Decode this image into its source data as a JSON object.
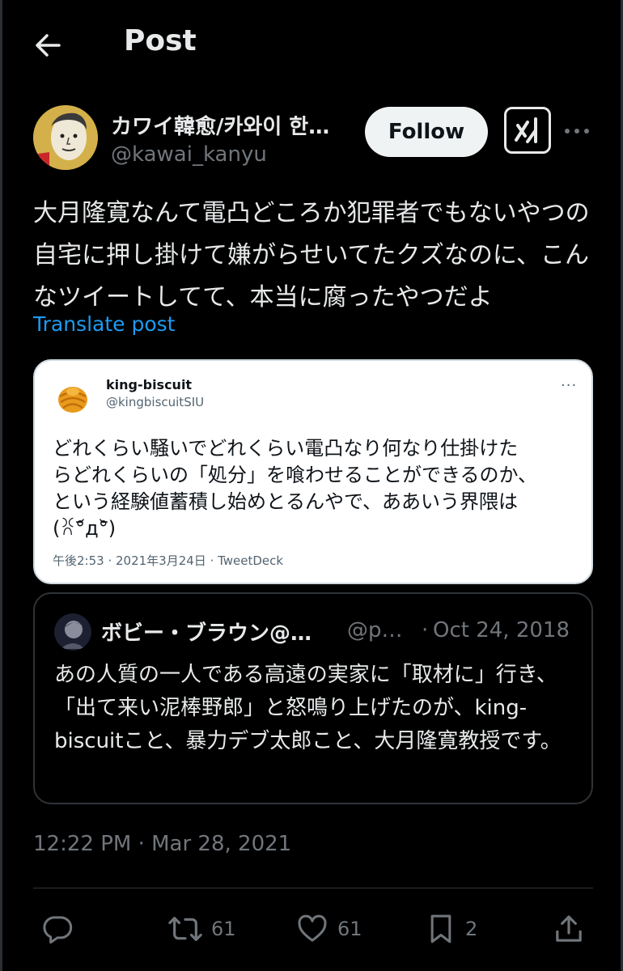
{
  "header": {
    "title": "Post"
  },
  "author": {
    "name": "カワイ韓愈/카와이 한…",
    "handle": "@kawai_kanyu",
    "follow_label": "Follow"
  },
  "tweet": {
    "text": "大月隆寛なんて電凸どころか犯罪者でもないやつの自宅に押し掛けて嫌がらせいてたクズなのに、こんなツイートしてて、本当に腐ったやつだよ",
    "translate_label": "Translate post"
  },
  "embedded_screenshot": {
    "name": "king-biscuit",
    "handle": "@kingbiscuitSIU",
    "more": "···",
    "text_lines": [
      "どれくらい騒いでどれくらい電凸なり何なり仕掛けた",
      "らどれくらいの「処分」を喰わせることができるのか、",
      "という経験値蓄積し始めとるんやで、ああいう界隈は",
      "(ꐦ°᷄д°᷅)"
    ],
    "meta": "午後2:53 · 2021年3月24日 · TweetDeck"
  },
  "quote": {
    "name": "ボビー・ブラウン@…",
    "handle": "@p…",
    "separator": "·",
    "date": "Oct 24, 2018",
    "text": "あの人質の一人である高遠の実家に「取材に」行き、「出て来い泥棒野郎」と怒鳴り上げたのが、king-biscuitこと、暴力デブ太郎こと、大月隆寛教授です。"
  },
  "timestamp": "12:22 PM · Mar 28, 2021",
  "actions": {
    "retweets": "61",
    "likes": "61",
    "bookmarks": "2"
  },
  "colors": {
    "background": "#000000",
    "link": "#1d9bf0",
    "secondary_text": "#71767b",
    "border": "#2f3336"
  }
}
